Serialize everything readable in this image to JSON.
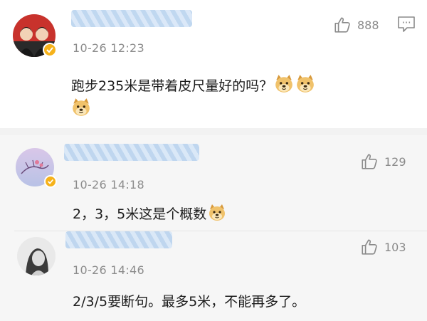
{
  "main_comment": {
    "time": "10-26 12:23",
    "likes": "888",
    "text": "跑步235米是带着皮尺量好的吗？"
  },
  "replies": [
    {
      "time": "10-26 14:18",
      "likes": "129",
      "text": "2，3，5米这是个概数"
    },
    {
      "time": "10-26 14:46",
      "likes": "103",
      "text": "2/3/5要断句。最多5米，不能再多了。"
    }
  ],
  "icons": {
    "like": "thumbs-up-icon",
    "comment": "comment-icon",
    "emoji": "doge-emoji-icon",
    "verified": "verified-badge-icon"
  },
  "colors": {
    "verified": "#f6b21a",
    "username_blur": "#b9d3ee",
    "muted_text": "#8c8c8c"
  }
}
